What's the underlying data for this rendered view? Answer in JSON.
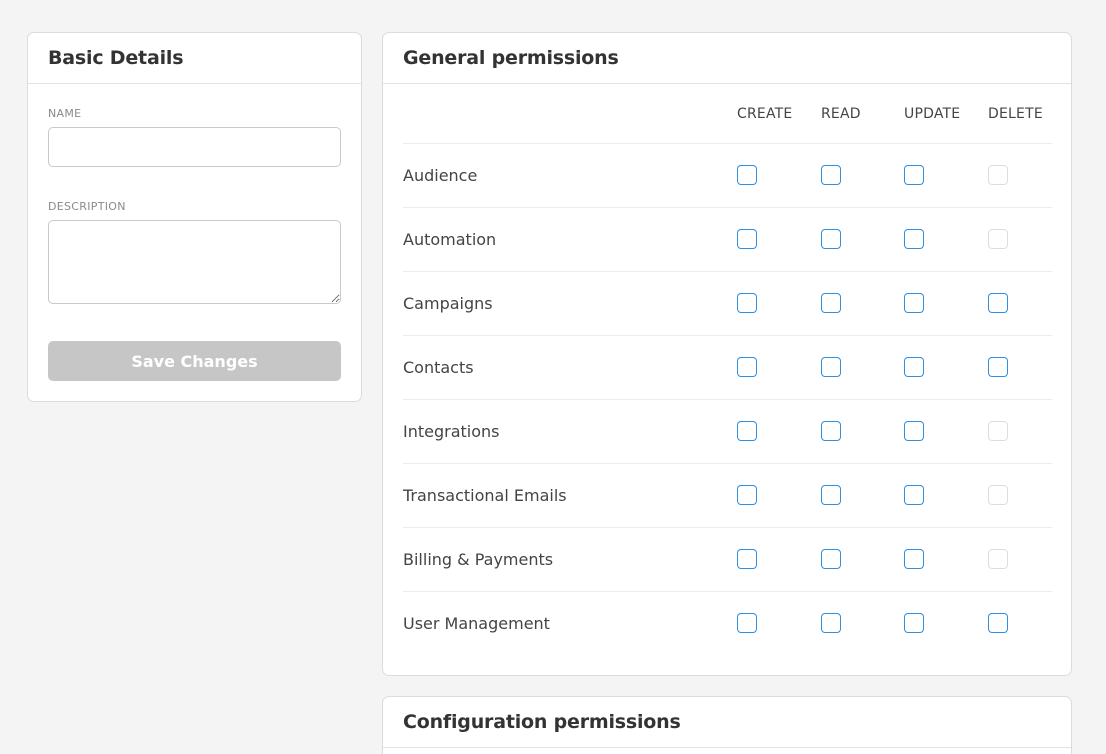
{
  "basic_details": {
    "title": "Basic Details",
    "name_label": "NAME",
    "name_value": "",
    "description_label": "DESCRIPTION",
    "description_value": "",
    "save_label": "Save Changes"
  },
  "general_permissions": {
    "title": "General permissions",
    "columns": [
      "CREATE",
      "READ",
      "UPDATE",
      "DELETE"
    ],
    "rows": [
      {
        "label": "Audience",
        "delete_enabled": false
      },
      {
        "label": "Automation",
        "delete_enabled": false
      },
      {
        "label": "Campaigns",
        "delete_enabled": true
      },
      {
        "label": "Contacts",
        "delete_enabled": true
      },
      {
        "label": "Integrations",
        "delete_enabled": false
      },
      {
        "label": "Transactional Emails",
        "delete_enabled": false
      },
      {
        "label": "Billing & Payments",
        "delete_enabled": false
      },
      {
        "label": "User Management",
        "delete_enabled": true
      }
    ]
  },
  "configuration_permissions": {
    "title": "Configuration permissions"
  },
  "colors": {
    "checkbox_border": "#2f8fe0",
    "disabled_checkbox_border": "#dedede",
    "save_button_disabled": "#c6c6c6",
    "page_background": "#f4f4f4"
  }
}
